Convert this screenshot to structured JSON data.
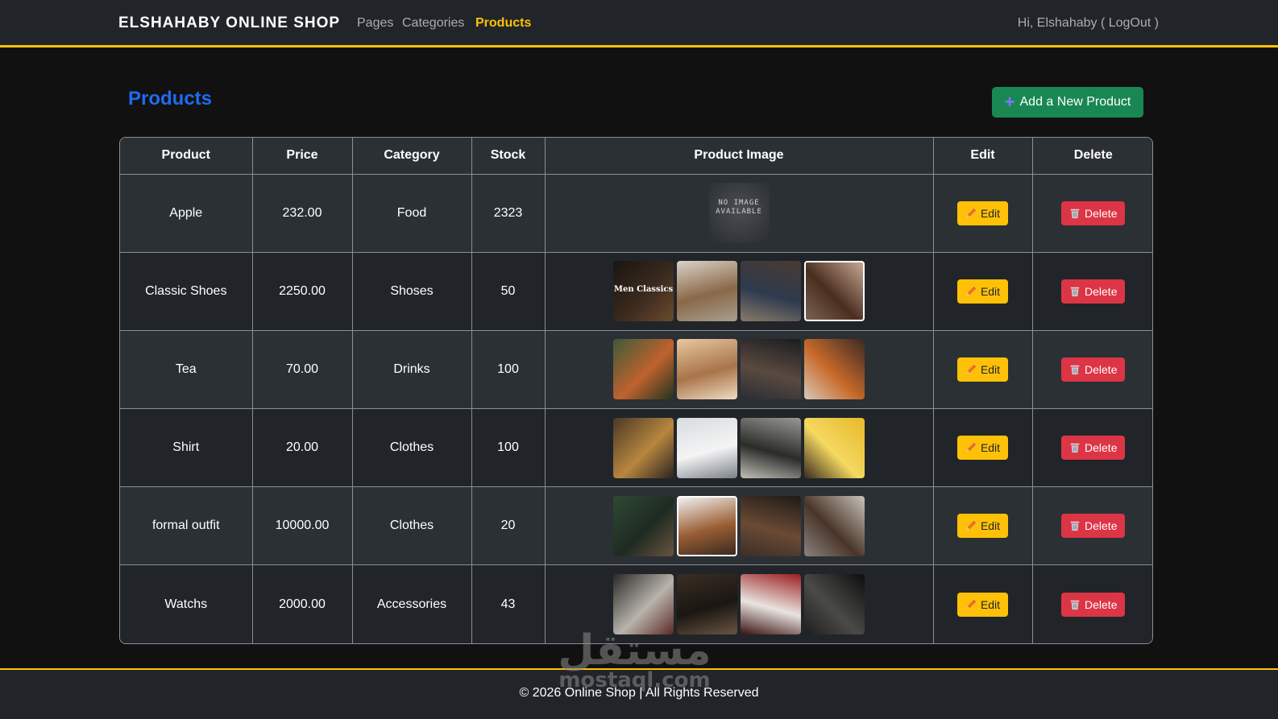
{
  "navbar": {
    "brand": "ELSHAHABY ONLINE SHOP",
    "links": [
      {
        "label": "Pages",
        "active": false
      },
      {
        "label": "Categories",
        "active": false
      },
      {
        "label": "Products",
        "active": true
      }
    ],
    "user": "Hi, Elshahaby ( LogOut )"
  },
  "page": {
    "title": "Products",
    "add_button": "Add a New Product"
  },
  "table": {
    "headers": [
      "Product",
      "Price",
      "Category",
      "Stock",
      "Product Image",
      "Edit",
      "Delete"
    ],
    "edit_label": "Edit",
    "delete_label": "Delete",
    "rows": [
      {
        "product": "Apple",
        "price": "232.00",
        "category": "Food",
        "stock": "2323",
        "no_image": {
          "line1": "NO IMAGE",
          "line2": "AVAILABLE"
        },
        "images": []
      },
      {
        "product": "Classic Shoes",
        "price": "2250.00",
        "category": "Shoses",
        "stock": "50",
        "images": [
          {
            "name": "men-classics",
            "caption": "Men Classics",
            "colors": [
              "#1a1512",
              "#3b2a1e",
              "#6b4a2e"
            ]
          },
          {
            "name": "loafer-shoe",
            "colors": [
              "#d9d3c8",
              "#8a6848",
              "#a89e90"
            ]
          },
          {
            "name": "walking-shoes",
            "colors": [
              "#4a3b30",
              "#2d3a4e",
              "#8a7a68"
            ]
          },
          {
            "name": "brown-oxford",
            "colors": [
              "#c8a894",
              "#4a2e20",
              "#7a6252"
            ]
          }
        ]
      },
      {
        "product": "Tea",
        "price": "70.00",
        "category": "Drinks",
        "stock": "100",
        "images": [
          {
            "name": "tea-leaves",
            "colors": [
              "#3d5a3a",
              "#c0622e",
              "#22331f"
            ]
          },
          {
            "name": "tea-candles",
            "colors": [
              "#e8c8a0",
              "#a8744a",
              "#f0dcc0"
            ]
          },
          {
            "name": "dark-tea-cups",
            "colors": [
              "#1a1c20",
              "#5a4a40",
              "#2a2e34"
            ]
          },
          {
            "name": "pouring-tea",
            "colors": [
              "#3a2a24",
              "#c86a2a",
              "#d8c8b8"
            ]
          }
        ]
      },
      {
        "product": "Shirt",
        "price": "20.00",
        "category": "Clothes",
        "stock": "100",
        "images": [
          {
            "name": "plaid-shirt",
            "colors": [
              "#4a3828",
              "#b8863e",
              "#2a2420"
            ]
          },
          {
            "name": "white-shirt",
            "colors": [
              "#d8dce0",
              "#f4f4f4",
              "#7a8088"
            ]
          },
          {
            "name": "dark-shirt",
            "colors": [
              "#9a9894",
              "#2a2c28",
              "#c0beb8"
            ]
          },
          {
            "name": "yellow-shirt",
            "colors": [
              "#e8b82a",
              "#f4d860",
              "#3a2a1e"
            ]
          }
        ]
      },
      {
        "product": "formal outfit",
        "price": "10000.00",
        "category": "Clothes",
        "stock": "20",
        "images": [
          {
            "name": "green-suit",
            "colors": [
              "#2e4a34",
              "#1e2a22",
              "#6a5440"
            ]
          },
          {
            "name": "brown-coat",
            "colors": [
              "#f2f0ee",
              "#9a5e34",
              "#3a2a20"
            ]
          },
          {
            "name": "watch-wrist",
            "colors": [
              "#1e1a18",
              "#6a4a34",
              "#3a2e28"
            ]
          },
          {
            "name": "loafer-dark",
            "colors": [
              "#c8c4bc",
              "#4a3428",
              "#8a8480"
            ]
          }
        ]
      },
      {
        "product": "Watchs",
        "price": "2000.00",
        "category": "Accessories",
        "stock": "43",
        "images": [
          {
            "name": "silver-watch",
            "colors": [
              "#2a2826",
              "#b8b4ac",
              "#5a2a24"
            ]
          },
          {
            "name": "black-watch-strap",
            "colors": [
              "#3a2e24",
              "#1a1612",
              "#6a5442"
            ]
          },
          {
            "name": "red-watch",
            "colors": [
              "#9a1e1e",
              "#e8e4e0",
              "#3a1010"
            ]
          },
          {
            "name": "night-watch",
            "colors": [
              "#0e0e0e",
              "#4a4a48",
              "#1e1e1e"
            ]
          }
        ]
      }
    ]
  },
  "footer": {
    "text": "© 2026 Online Shop | All Rights Reserved"
  },
  "watermark": {
    "arabic": "مستقل",
    "latin": "mostaql.com"
  },
  "colors": {
    "accent": "#ffc107",
    "title_blue": "#1e6bf0",
    "success": "#198754",
    "danger": "#dc3545"
  }
}
